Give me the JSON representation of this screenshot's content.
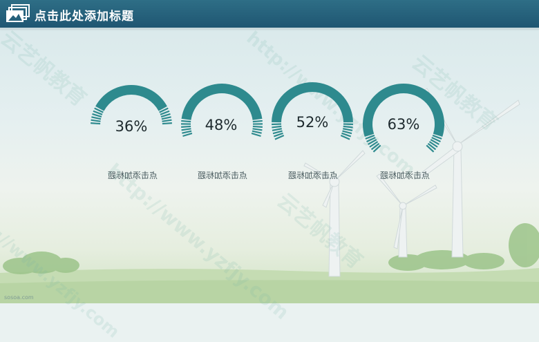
{
  "header": {
    "title": "点击此处添加标题",
    "logo_icon": "slides-logo-icon"
  },
  "donuts": [
    {
      "percent_label": "36%",
      "caption": "点击添加标题",
      "level": 0.36
    },
    {
      "percent_label": "48%",
      "caption": "点击添加标题",
      "level": 0.48
    },
    {
      "percent_label": "52%",
      "caption": "点击添加标题",
      "level": 0.52
    },
    {
      "percent_label": "63%",
      "caption": "点击添加标题",
      "level": 0.63
    }
  ],
  "colors": {
    "header": "#25617b",
    "ring": "#2e8a8e",
    "ring_light": "#3d9a9c",
    "text": "#1e2a2e"
  },
  "watermarks": [
    "云艺帆教育",
    "http://www.yzfjy.com"
  ],
  "footer": "sosoa.com"
}
